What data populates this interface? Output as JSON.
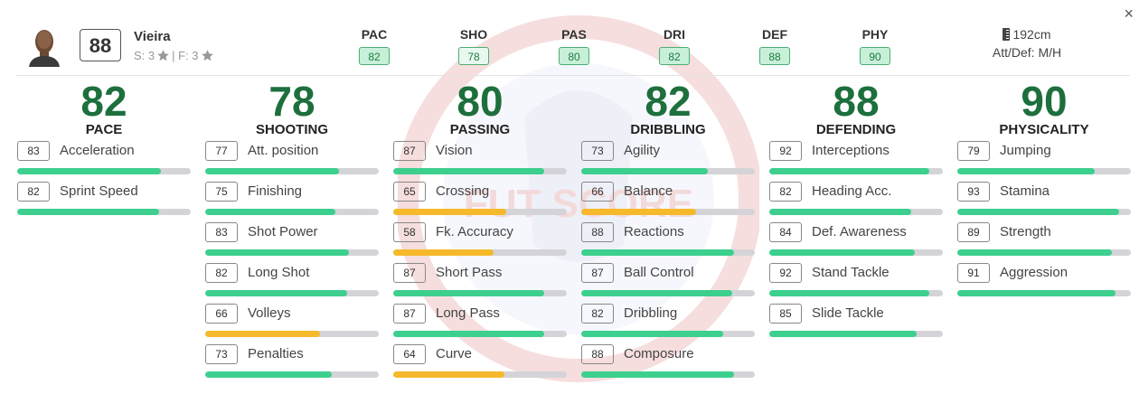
{
  "player": {
    "name": "Vieira",
    "overall": "88",
    "skills_text": "S: 3",
    "weakfoot_text": "| F: 3",
    "height": "192cm",
    "workrates": "Att/Def: M/H"
  },
  "header_stats": [
    {
      "label": "PAC",
      "value": "82"
    },
    {
      "label": "SHO",
      "value": "78"
    },
    {
      "label": "PAS",
      "value": "80"
    },
    {
      "label": "DRI",
      "value": "82"
    },
    {
      "label": "DEF",
      "value": "88"
    },
    {
      "label": "PHY",
      "value": "90"
    }
  ],
  "categories": [
    {
      "name": "PACE",
      "value": "82",
      "attrs": [
        {
          "name": "Acceleration",
          "value": 83
        },
        {
          "name": "Sprint Speed",
          "value": 82
        }
      ]
    },
    {
      "name": "SHOOTING",
      "value": "78",
      "attrs": [
        {
          "name": "Att. position",
          "value": 77
        },
        {
          "name": "Finishing",
          "value": 75
        },
        {
          "name": "Shot Power",
          "value": 83
        },
        {
          "name": "Long Shot",
          "value": 82
        },
        {
          "name": "Volleys",
          "value": 66
        },
        {
          "name": "Penalties",
          "value": 73
        }
      ]
    },
    {
      "name": "PASSING",
      "value": "80",
      "attrs": [
        {
          "name": "Vision",
          "value": 87
        },
        {
          "name": "Crossing",
          "value": 65
        },
        {
          "name": "Fk. Accuracy",
          "value": 58
        },
        {
          "name": "Short Pass",
          "value": 87
        },
        {
          "name": "Long Pass",
          "value": 87
        },
        {
          "name": "Curve",
          "value": 64
        }
      ]
    },
    {
      "name": "DRIBBLING",
      "value": "82",
      "attrs": [
        {
          "name": "Agility",
          "value": 73
        },
        {
          "name": "Balance",
          "value": 66
        },
        {
          "name": "Reactions",
          "value": 88
        },
        {
          "name": "Ball Control",
          "value": 87
        },
        {
          "name": "Dribbling",
          "value": 82
        },
        {
          "name": "Composure",
          "value": 88
        }
      ]
    },
    {
      "name": "DEFENDING",
      "value": "88",
      "attrs": [
        {
          "name": "Interceptions",
          "value": 92
        },
        {
          "name": "Heading Acc.",
          "value": 82
        },
        {
          "name": "Def. Awareness",
          "value": 84
        },
        {
          "name": "Stand Tackle",
          "value": 92
        },
        {
          "name": "Slide Tackle",
          "value": 85
        }
      ]
    },
    {
      "name": "PHYSICALITY",
      "value": "90",
      "attrs": [
        {
          "name": "Jumping",
          "value": 79
        },
        {
          "name": "Stamina",
          "value": 93
        },
        {
          "name": "Strength",
          "value": 89
        },
        {
          "name": "Aggression",
          "value": 91
        }
      ]
    }
  ],
  "colors": {
    "high": "#3ccf8e",
    "mid": "#f6b92b",
    "track": "#d4d4d8",
    "big_number": "#1d6f3c"
  },
  "icons": {
    "close": "close-icon",
    "star": "star-icon",
    "height": "height-icon"
  },
  "close_label": "×",
  "watermark_text": "FUT SCORE"
}
